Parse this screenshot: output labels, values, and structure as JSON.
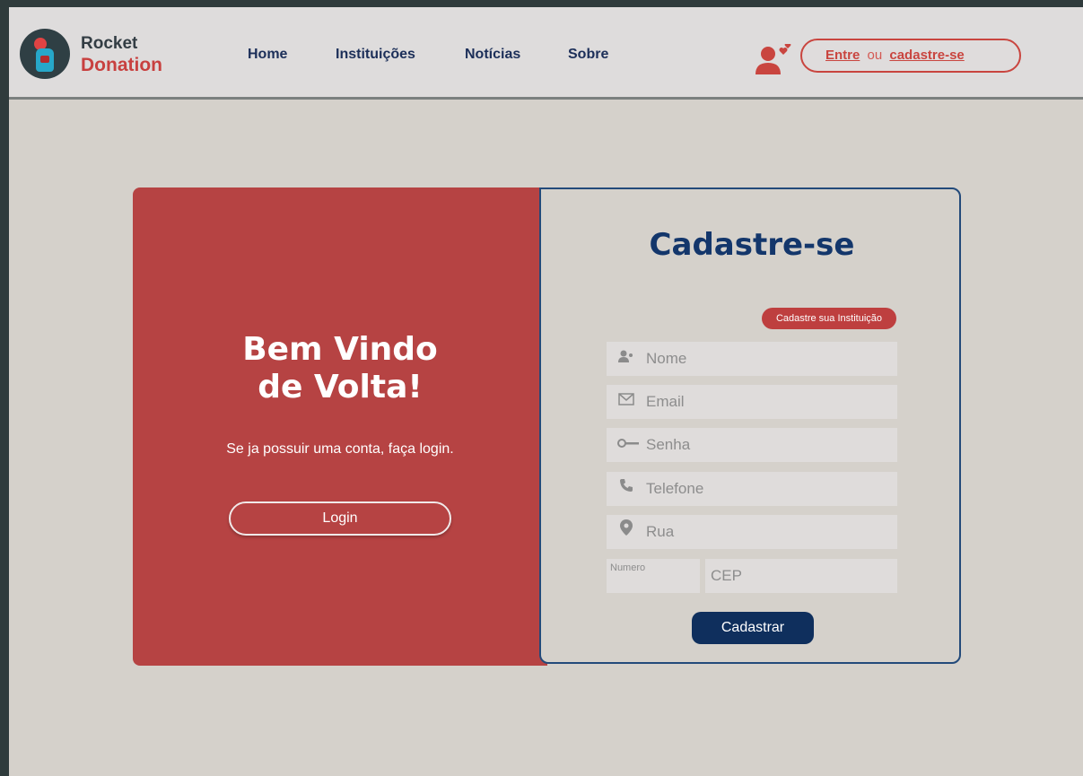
{
  "brand": {
    "line1": "Rocket",
    "line2": "Donation"
  },
  "nav": [
    {
      "label": "Home"
    },
    {
      "label": "Instituições"
    },
    {
      "label": "Notícias"
    },
    {
      "label": "Sobre"
    }
  ],
  "auth": {
    "entre": "Entre",
    "ou": "ou",
    "cadastre": "cadastre-se"
  },
  "welcome": {
    "title_line1": "Bem Vindo",
    "title_line2": "de Volta!",
    "subtitle": "Se ja possuir uma conta, faça login.",
    "login_label": "Login"
  },
  "register": {
    "title": "Cadastre-se",
    "institution_badge": "Cadastre sua Instituição",
    "fields": {
      "nome": "Nome",
      "email": "Email",
      "senha": "Senha",
      "telefone": "Telefone",
      "rua": "Rua",
      "numero": "Numero",
      "cep": "CEP"
    },
    "submit_label": "Cadastrar"
  },
  "colors": {
    "primary_red": "#b64343",
    "accent_red": "#c9453f",
    "navy": "#13366b",
    "button_navy": "#0f2f5d",
    "background": "#d5d1cb"
  },
  "icons": {
    "nome": "user-icon",
    "email": "envelope-icon",
    "senha": "key-icon",
    "telefone": "phone-icon",
    "rua": "location-pin-icon"
  }
}
